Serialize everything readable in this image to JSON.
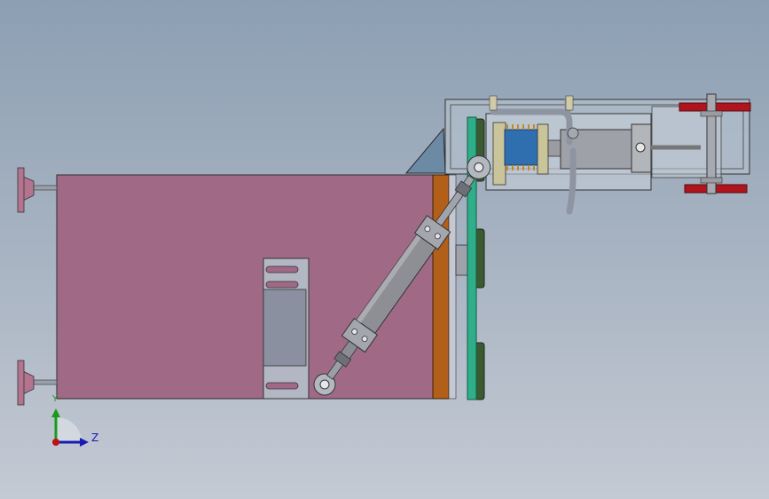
{
  "viewport": {
    "background_top": "#8c9fb3",
    "background_bottom": "#c4cad4"
  },
  "colors": {
    "base_block": "#a06a87",
    "wood_plate": "#b25f1a",
    "teal_plate": "#2fae8a",
    "dark_wheel": "#3c5a32",
    "steel": "#8d8f95",
    "steel_dark": "#55575c",
    "cylinder_blue": "#2f6fb0",
    "spring": "#c08a2a",
    "red_part": "#b0141c",
    "foot_pink": "#b4738f",
    "axis_y": "#1a9a1a",
    "axis_z": "#1a1ab4",
    "axis_origin": "#c01010"
  },
  "triad": {
    "y_label": "Y",
    "z_label": "Z"
  }
}
